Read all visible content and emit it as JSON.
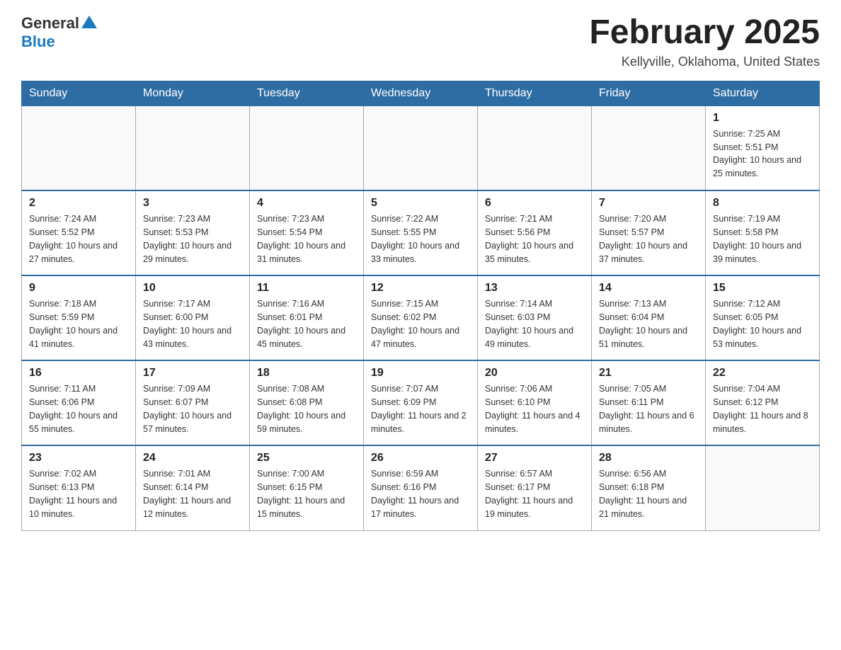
{
  "header": {
    "logo_general": "General",
    "logo_blue": "Blue",
    "title": "February 2025",
    "subtitle": "Kellyville, Oklahoma, United States"
  },
  "days_of_week": [
    "Sunday",
    "Monday",
    "Tuesday",
    "Wednesday",
    "Thursday",
    "Friday",
    "Saturday"
  ],
  "weeks": [
    [
      {
        "day": "",
        "sunrise": "",
        "sunset": "",
        "daylight": ""
      },
      {
        "day": "",
        "sunrise": "",
        "sunset": "",
        "daylight": ""
      },
      {
        "day": "",
        "sunrise": "",
        "sunset": "",
        "daylight": ""
      },
      {
        "day": "",
        "sunrise": "",
        "sunset": "",
        "daylight": ""
      },
      {
        "day": "",
        "sunrise": "",
        "sunset": "",
        "daylight": ""
      },
      {
        "day": "",
        "sunrise": "",
        "sunset": "",
        "daylight": ""
      },
      {
        "day": "1",
        "sunrise": "Sunrise: 7:25 AM",
        "sunset": "Sunset: 5:51 PM",
        "daylight": "Daylight: 10 hours and 25 minutes."
      }
    ],
    [
      {
        "day": "2",
        "sunrise": "Sunrise: 7:24 AM",
        "sunset": "Sunset: 5:52 PM",
        "daylight": "Daylight: 10 hours and 27 minutes."
      },
      {
        "day": "3",
        "sunrise": "Sunrise: 7:23 AM",
        "sunset": "Sunset: 5:53 PM",
        "daylight": "Daylight: 10 hours and 29 minutes."
      },
      {
        "day": "4",
        "sunrise": "Sunrise: 7:23 AM",
        "sunset": "Sunset: 5:54 PM",
        "daylight": "Daylight: 10 hours and 31 minutes."
      },
      {
        "day": "5",
        "sunrise": "Sunrise: 7:22 AM",
        "sunset": "Sunset: 5:55 PM",
        "daylight": "Daylight: 10 hours and 33 minutes."
      },
      {
        "day": "6",
        "sunrise": "Sunrise: 7:21 AM",
        "sunset": "Sunset: 5:56 PM",
        "daylight": "Daylight: 10 hours and 35 minutes."
      },
      {
        "day": "7",
        "sunrise": "Sunrise: 7:20 AM",
        "sunset": "Sunset: 5:57 PM",
        "daylight": "Daylight: 10 hours and 37 minutes."
      },
      {
        "day": "8",
        "sunrise": "Sunrise: 7:19 AM",
        "sunset": "Sunset: 5:58 PM",
        "daylight": "Daylight: 10 hours and 39 minutes."
      }
    ],
    [
      {
        "day": "9",
        "sunrise": "Sunrise: 7:18 AM",
        "sunset": "Sunset: 5:59 PM",
        "daylight": "Daylight: 10 hours and 41 minutes."
      },
      {
        "day": "10",
        "sunrise": "Sunrise: 7:17 AM",
        "sunset": "Sunset: 6:00 PM",
        "daylight": "Daylight: 10 hours and 43 minutes."
      },
      {
        "day": "11",
        "sunrise": "Sunrise: 7:16 AM",
        "sunset": "Sunset: 6:01 PM",
        "daylight": "Daylight: 10 hours and 45 minutes."
      },
      {
        "day": "12",
        "sunrise": "Sunrise: 7:15 AM",
        "sunset": "Sunset: 6:02 PM",
        "daylight": "Daylight: 10 hours and 47 minutes."
      },
      {
        "day": "13",
        "sunrise": "Sunrise: 7:14 AM",
        "sunset": "Sunset: 6:03 PM",
        "daylight": "Daylight: 10 hours and 49 minutes."
      },
      {
        "day": "14",
        "sunrise": "Sunrise: 7:13 AM",
        "sunset": "Sunset: 6:04 PM",
        "daylight": "Daylight: 10 hours and 51 minutes."
      },
      {
        "day": "15",
        "sunrise": "Sunrise: 7:12 AM",
        "sunset": "Sunset: 6:05 PM",
        "daylight": "Daylight: 10 hours and 53 minutes."
      }
    ],
    [
      {
        "day": "16",
        "sunrise": "Sunrise: 7:11 AM",
        "sunset": "Sunset: 6:06 PM",
        "daylight": "Daylight: 10 hours and 55 minutes."
      },
      {
        "day": "17",
        "sunrise": "Sunrise: 7:09 AM",
        "sunset": "Sunset: 6:07 PM",
        "daylight": "Daylight: 10 hours and 57 minutes."
      },
      {
        "day": "18",
        "sunrise": "Sunrise: 7:08 AM",
        "sunset": "Sunset: 6:08 PM",
        "daylight": "Daylight: 10 hours and 59 minutes."
      },
      {
        "day": "19",
        "sunrise": "Sunrise: 7:07 AM",
        "sunset": "Sunset: 6:09 PM",
        "daylight": "Daylight: 11 hours and 2 minutes."
      },
      {
        "day": "20",
        "sunrise": "Sunrise: 7:06 AM",
        "sunset": "Sunset: 6:10 PM",
        "daylight": "Daylight: 11 hours and 4 minutes."
      },
      {
        "day": "21",
        "sunrise": "Sunrise: 7:05 AM",
        "sunset": "Sunset: 6:11 PM",
        "daylight": "Daylight: 11 hours and 6 minutes."
      },
      {
        "day": "22",
        "sunrise": "Sunrise: 7:04 AM",
        "sunset": "Sunset: 6:12 PM",
        "daylight": "Daylight: 11 hours and 8 minutes."
      }
    ],
    [
      {
        "day": "23",
        "sunrise": "Sunrise: 7:02 AM",
        "sunset": "Sunset: 6:13 PM",
        "daylight": "Daylight: 11 hours and 10 minutes."
      },
      {
        "day": "24",
        "sunrise": "Sunrise: 7:01 AM",
        "sunset": "Sunset: 6:14 PM",
        "daylight": "Daylight: 11 hours and 12 minutes."
      },
      {
        "day": "25",
        "sunrise": "Sunrise: 7:00 AM",
        "sunset": "Sunset: 6:15 PM",
        "daylight": "Daylight: 11 hours and 15 minutes."
      },
      {
        "day": "26",
        "sunrise": "Sunrise: 6:59 AM",
        "sunset": "Sunset: 6:16 PM",
        "daylight": "Daylight: 11 hours and 17 minutes."
      },
      {
        "day": "27",
        "sunrise": "Sunrise: 6:57 AM",
        "sunset": "Sunset: 6:17 PM",
        "daylight": "Daylight: 11 hours and 19 minutes."
      },
      {
        "day": "28",
        "sunrise": "Sunrise: 6:56 AM",
        "sunset": "Sunset: 6:18 PM",
        "daylight": "Daylight: 11 hours and 21 minutes."
      },
      {
        "day": "",
        "sunrise": "",
        "sunset": "",
        "daylight": ""
      }
    ]
  ]
}
